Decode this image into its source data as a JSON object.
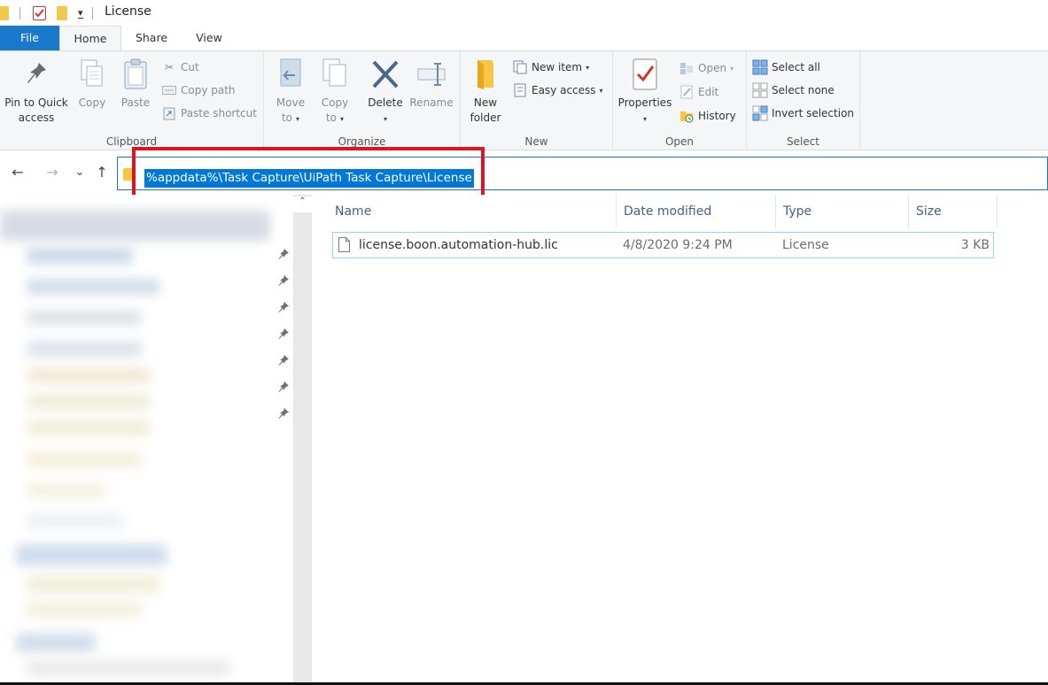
{
  "window": {
    "title": "License",
    "qat_dropdown_glyph": "▾"
  },
  "ribbon_tabs": [
    {
      "label": "File"
    },
    {
      "label": "Home"
    },
    {
      "label": "Share"
    },
    {
      "label": "View"
    }
  ],
  "ribbon": {
    "clipboard": {
      "group_label": "Clipboard",
      "pin_line1": "Pin to Quick",
      "pin_line2": "access",
      "copy": "Copy",
      "paste": "Paste",
      "cut": "Cut",
      "copy_path": "Copy path",
      "paste_shortcut": "Paste shortcut"
    },
    "organize": {
      "group_label": "Organize",
      "move_line1": "Move",
      "move_line2": "to",
      "copy_line1": "Copy",
      "copy_line2": "to",
      "delete": "Delete",
      "rename": "Rename"
    },
    "new": {
      "group_label": "New",
      "new_folder_line1": "New",
      "new_folder_line2": "folder",
      "new_item": "New item",
      "easy_access": "Easy access"
    },
    "open": {
      "group_label": "Open",
      "properties": "Properties",
      "open": "Open",
      "edit": "Edit",
      "history": "History"
    },
    "select": {
      "group_label": "Select",
      "select_all": "Select all",
      "select_none": "Select none",
      "invert_selection": "Invert selection"
    }
  },
  "navigation": {
    "back": "←",
    "forward": "→",
    "recent": "⌄",
    "up": "↑"
  },
  "address": {
    "value": "%appdata%\\Task Capture\\UiPath Task Capture\\License"
  },
  "file_list": {
    "columns": [
      "Name",
      "Date modified",
      "Type",
      "Size"
    ],
    "rows": [
      {
        "name": "license.boon.automation-hub.lic",
        "date_modified": "4/8/2020 9:24 PM",
        "type": "License",
        "size": "3 KB"
      }
    ]
  },
  "colors": {
    "accent": "#1979ca",
    "selection": "#0078d7",
    "highlight_annotation": "#e0141e"
  }
}
